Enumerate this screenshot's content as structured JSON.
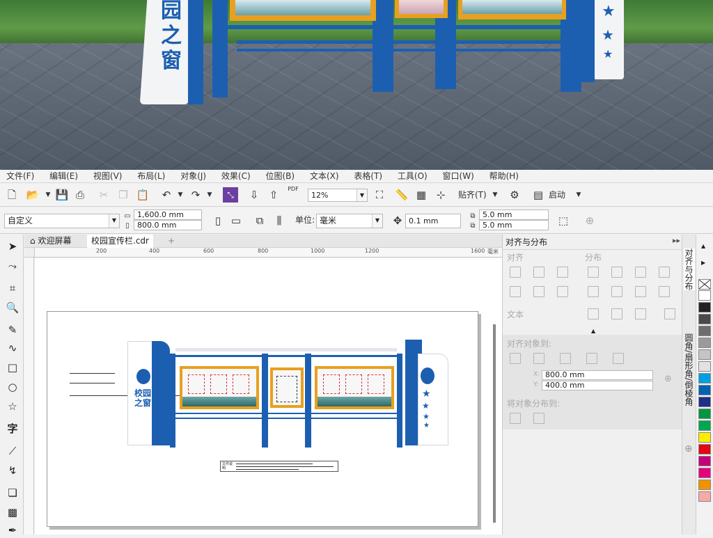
{
  "menu": [
    "文件(F)",
    "编辑(E)",
    "视图(V)",
    "布局(L)",
    "对象(J)",
    "效果(C)",
    "位图(B)",
    "文本(X)",
    "表格(T)",
    "工具(O)",
    "窗口(W)",
    "帮助(H)"
  ],
  "toolbar": {
    "zoom_value": "12%",
    "snap_label": "贴齐(T)",
    "launch_label": "启动",
    "pdf_label": "PDF"
  },
  "propertybar": {
    "page_preset": "自定义",
    "width_value": "1,600.0 mm",
    "height_value": "800.0 mm",
    "unit_label": "单位:",
    "unit_value": "毫米",
    "nudge_value": "0.1 mm",
    "dup_x_value": "5.0 mm",
    "dup_y_value": "5.0 mm"
  },
  "tabs": [
    {
      "label": "欢迎屏幕"
    },
    {
      "label": "校园宣传栏.cdr"
    }
  ],
  "ruler_ticks": [
    "200",
    "400",
    "600",
    "800",
    "1000",
    "1200",
    "1600"
  ],
  "ruler_unit": "毫米",
  "design": {
    "sign_text": "校园之窗",
    "note_text": "文件说明"
  },
  "scene": {
    "sign_text": "园之窗"
  },
  "docker": {
    "title": "对齐与分布",
    "section_align": "对齐",
    "section_distribute": "分布",
    "section_text": "文本",
    "section_align_to": "对齐对象到:",
    "x_value": "800.0 mm",
    "y_value": "400.0 mm",
    "x_label": "X:",
    "y_label": "Y:",
    "section_distribute_to": "将对象分布到:"
  },
  "side_tabs": [
    "对齐与分布",
    "圆角/扇形角/倒棱角"
  ],
  "palette": [
    "#ffffff",
    "#222222",
    "#4a4a4a",
    "#6e6e6e",
    "#9a9a9a",
    "#c4c4c4",
    "#e2e2e2",
    "#009fe3",
    "#0062b0",
    "#1d2f87",
    "#009640",
    "#00a650",
    "#ffed00",
    "#e30613",
    "#c4007a",
    "#e6007e",
    "#f39200",
    "#f7a9a8"
  ],
  "colors": {
    "accent_blue": "#1c5fb0",
    "accent_orange": "#e8a020"
  }
}
